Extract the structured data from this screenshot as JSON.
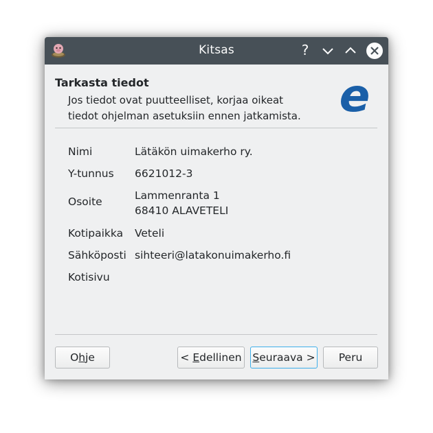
{
  "window": {
    "title": "Kitsas",
    "help_glyph": "?",
    "icons": [
      "app-icon",
      "help-icon",
      "minimize-icon",
      "maximize-icon",
      "close-icon"
    ]
  },
  "header": {
    "title": "Tarkasta tiedot",
    "description_line1": "Jos tiedot ovat puutteelliset, korjaa oikeat",
    "description_line2": "tiedot ohjelman asetuksiin ennen jatkamista."
  },
  "fields": {
    "name_label": "Nimi",
    "name_value": "Lätäkön uimakerho ry.",
    "ytunnus_label": "Y-tunnus",
    "ytunnus_value": "6621012-3",
    "address_label": "Osoite",
    "address_line1": "Lammenranta 1",
    "address_line2": "68410 ALAVETELI",
    "kotipaikka_label": "Kotipaikka",
    "kotipaikka_value": "Veteli",
    "email_label": "Sähköposti",
    "email_value": "sihteeri@latakonuimakerho.fi",
    "website_label": "Kotisivu"
  },
  "buttons": {
    "help_pre": "O",
    "help_ul": "h",
    "help_post": "je",
    "back_pre": "< ",
    "back_ul": "E",
    "back_post": "dellinen",
    "next_ul": "S",
    "next_post": "euraava >",
    "cancel": "Peru"
  },
  "colors": {
    "titlebar": "#475057",
    "dialog_bg": "#eff0f1",
    "logo_blue": "#1a5fa8",
    "focus_border": "#3daee9"
  }
}
